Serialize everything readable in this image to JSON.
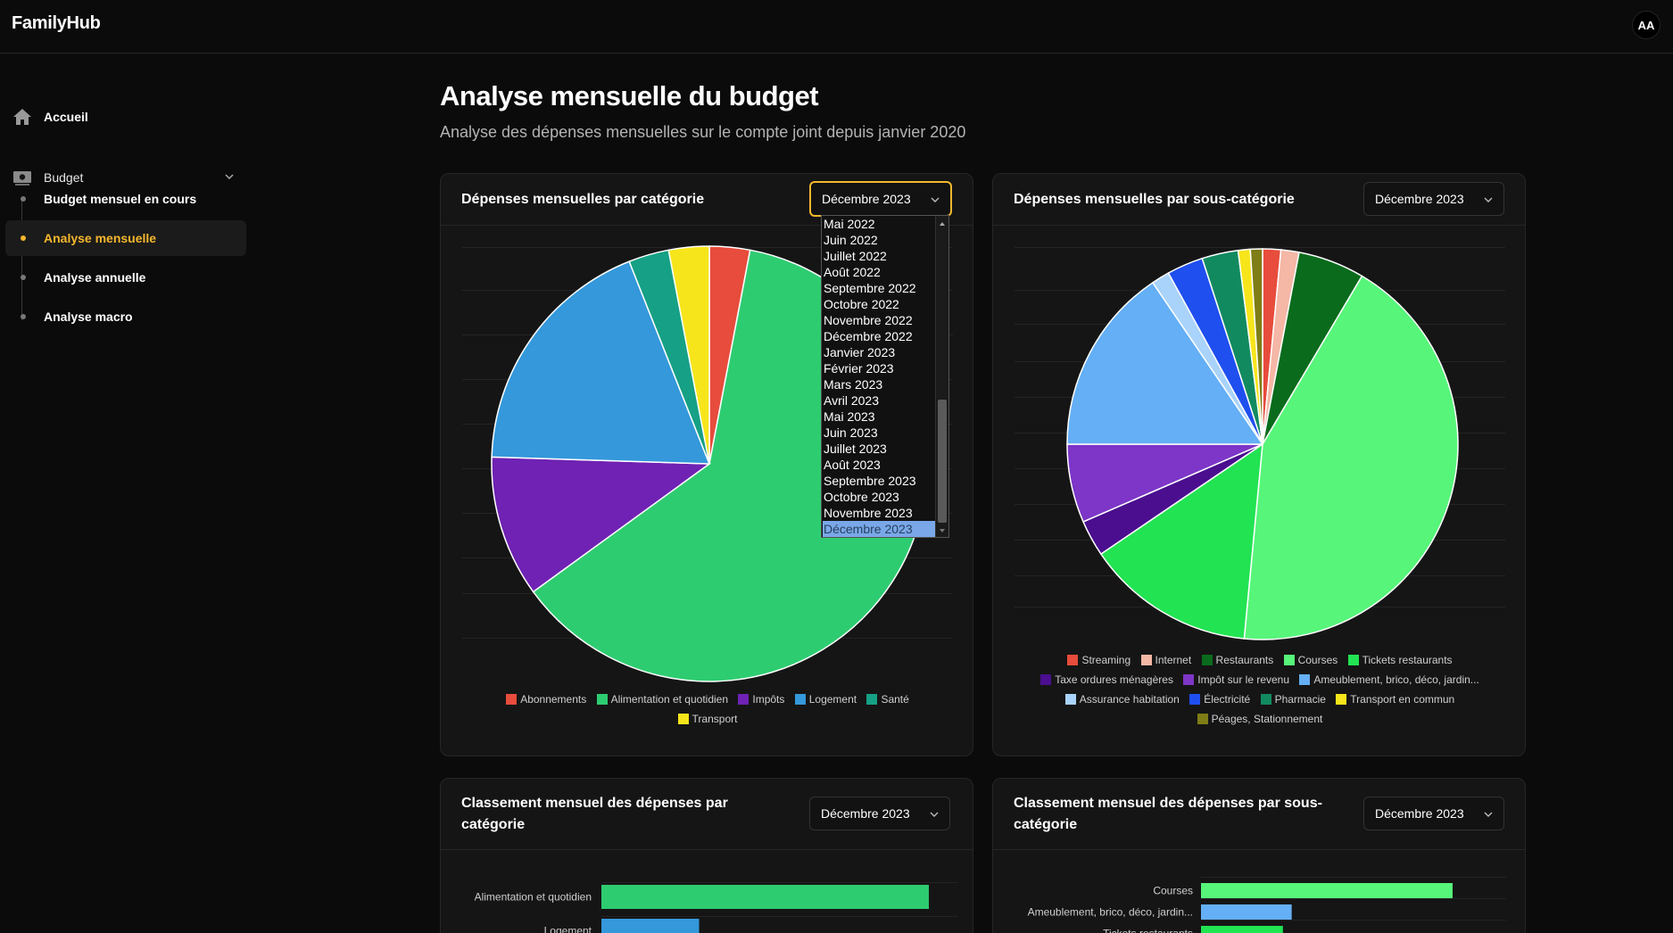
{
  "app": {
    "brand": "FamilyHub",
    "avatar": "AA"
  },
  "sidebar": {
    "home": {
      "label": "Accueil",
      "icon": "home-icon"
    },
    "budget": {
      "label": "Budget",
      "icon": "money-icon"
    },
    "sub_items": [
      {
        "label": "Budget mensuel en cours",
        "active": false
      },
      {
        "label": "Analyse mensuelle",
        "active": true
      },
      {
        "label": "Analyse annuelle",
        "active": false
      },
      {
        "label": "Analyse macro",
        "active": false
      }
    ]
  },
  "page": {
    "title": "Analyse mensuelle du budget",
    "subtitle": "Analyse des dépenses mensuelles sur le compte joint depuis janvier 2020"
  },
  "cards": {
    "cat_pie": {
      "title": "Dépenses mensuelles par catégorie",
      "month": "Décembre 2023"
    },
    "subcat_pie": {
      "title": "Dépenses mensuelles par sous-catégorie",
      "month": "Décembre 2023"
    },
    "cat_rank": {
      "title": "Classement mensuel des dépenses par catégorie",
      "month": "Décembre 2023"
    },
    "subcat_rank": {
      "title": "Classement mensuel des dépenses par sous-catégorie",
      "month": "Décembre 2023"
    }
  },
  "dropdown": {
    "options": [
      "Mai 2022",
      "Juin 2022",
      "Juillet 2022",
      "Août 2022",
      "Septembre 2022",
      "Octobre 2022",
      "Novembre 2022",
      "Décembre 2022",
      "Janvier 2023",
      "Février 2023",
      "Mars 2023",
      "Avril 2023",
      "Mai 2023",
      "Juin 2023",
      "Juillet 2023",
      "Août 2023",
      "Septembre 2023",
      "Octobre 2023",
      "Novembre 2023",
      "Décembre 2023"
    ],
    "selected": "Décembre 2023"
  },
  "colors": {
    "accent": "#f5b72d",
    "background": "#0b0b0b",
    "card": "#151515"
  },
  "chart_data": [
    {
      "type": "pie",
      "categories": [
        "Abonnements",
        "Alimentation et quotidien",
        "Impôts",
        "Logement",
        "Santé",
        "Transport"
      ],
      "values": [
        3,
        62,
        10.5,
        18.5,
        3,
        3
      ],
      "colors": [
        "#e74c3c",
        "#2ecc71",
        "#6f22b3",
        "#3498db",
        "#16a085",
        "#f7e51b"
      ]
    },
    {
      "type": "pie",
      "categories": [
        "Streaming",
        "Internet",
        "Restaurants",
        "Courses",
        "Tickets restaurants",
        "Taxe ordures ménagères",
        "Impôt sur le revenu",
        "Ameublement, brico, déco, jardin...",
        "Assurance habitation",
        "Électricité",
        "Pharmacie",
        "Transport en commun",
        "Péages, Stationnement"
      ],
      "values": [
        1.5,
        1.5,
        5.5,
        43,
        14,
        3,
        6.5,
        15.5,
        1.5,
        3,
        3,
        1,
        1
      ],
      "colors": [
        "#e74c3c",
        "#f5b7a6",
        "#0a6b1c",
        "#57f57a",
        "#22e352",
        "#4a0e8f",
        "#7d36c7",
        "#64aff5",
        "#a9d3fa",
        "#1f4fef",
        "#128a60",
        "#f7e51b",
        "#7e7d16"
      ]
    },
    {
      "type": "bar",
      "categories": [
        "Alimentation et quotidien",
        "Logement"
      ],
      "values": [
        62,
        18.5
      ],
      "colors": [
        "#2ecc71",
        "#3498db"
      ]
    },
    {
      "type": "bar",
      "categories": [
        "Courses",
        "Ameublement, brico, déco, jardin...",
        "Tickets restaurants"
      ],
      "values": [
        43,
        15.5,
        14
      ],
      "colors": [
        "#57f57a",
        "#64aff5",
        "#22e352"
      ]
    }
  ]
}
